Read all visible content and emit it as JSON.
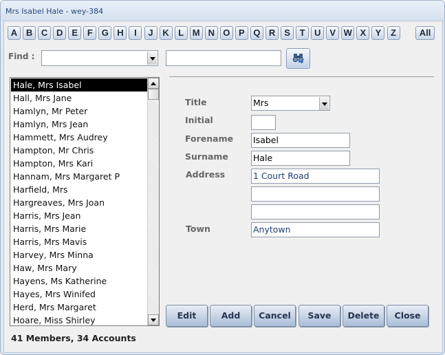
{
  "window": {
    "title": "Mrs Isabel Hale - wey-384"
  },
  "alphabet": {
    "letters": [
      "A",
      "B",
      "C",
      "D",
      "E",
      "F",
      "G",
      "H",
      "I",
      "J",
      "K",
      "L",
      "M",
      "N",
      "O",
      "P",
      "Q",
      "R",
      "S",
      "T",
      "U",
      "V",
      "W",
      "X",
      "Y",
      "Z"
    ],
    "all_label": "All"
  },
  "find": {
    "label": "Find :",
    "combo_value": "",
    "text_value": "",
    "button_icon": "binoculars-icon"
  },
  "members": {
    "selected_index": 0,
    "items": [
      "Hale, Mrs Isabel",
      "Hall, Mrs Jane",
      "Hamlyn, Mr Peter",
      "Hamlyn, Mrs Jean",
      "Hammett, Mrs Audrey",
      "Hampton, Mr Chris",
      "Hampton, Mrs Kari",
      "Hannam, Mrs Margaret P",
      "Harfield, Mrs",
      "Hargreaves, Mrs Joan",
      "Harris, Mrs Jean",
      "Harris, Mrs Marie",
      "Harris, Mrs Mavis",
      "Harvey, Mrs Minna",
      "Haw, Mrs Mary",
      "Hayens, Ms Katherine",
      "Hayes, Mrs Winifed",
      "Herd, Mrs Margaret",
      "Hoare, Miss Shirley"
    ],
    "summary": "41 Members, 34 Accounts"
  },
  "form": {
    "title_label": "Title",
    "title_value": "Mrs",
    "initial_label": "Initial",
    "initial_value": "",
    "forename_label": "Forename",
    "forename_value": "Isabel",
    "surname_label": "Surname",
    "surname_value": "Hale",
    "address_label": "Address",
    "address_lines": [
      "1 Court Road",
      "",
      ""
    ],
    "town_label": "Town",
    "town_value": "Anytown"
  },
  "actions": {
    "edit": "Edit",
    "add": "Add",
    "cancel": "Cancel",
    "save": "Save",
    "delete": "Delete",
    "close": "Close"
  },
  "colors": {
    "selection": "#000000",
    "field_text_blue": "#1f3f78",
    "window_frame": "#dfe9f5"
  }
}
